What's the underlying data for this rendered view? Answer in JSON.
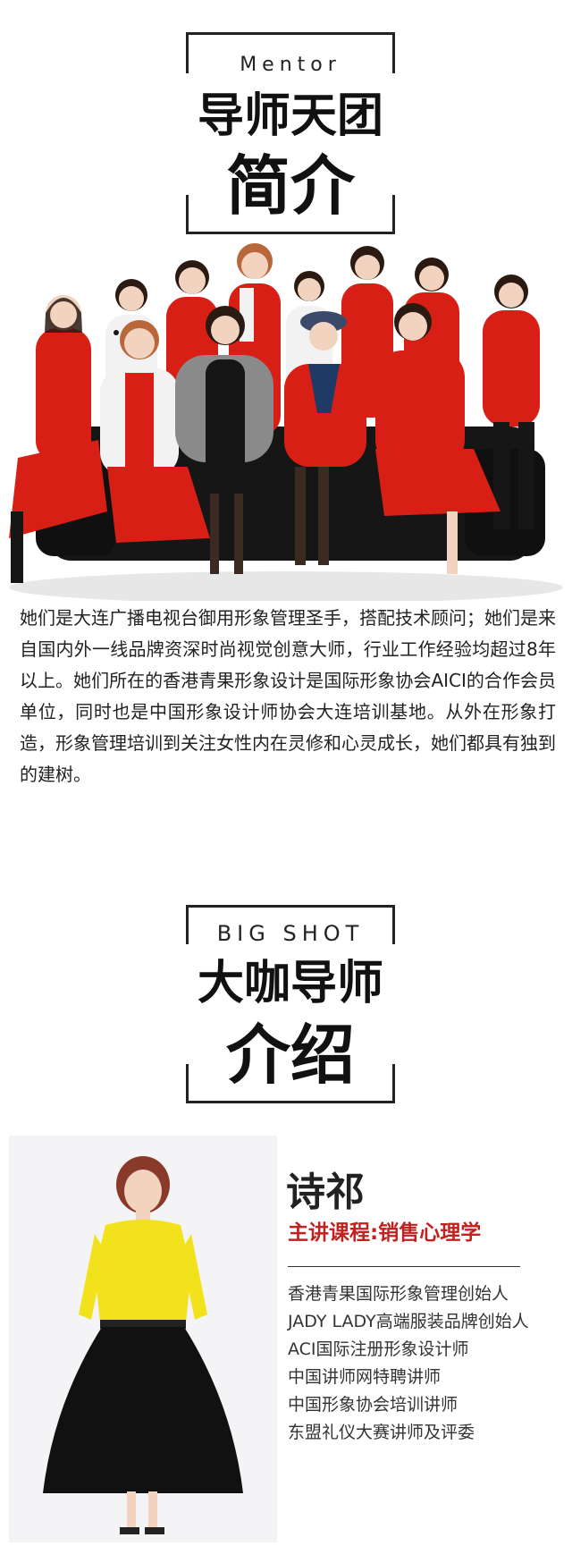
{
  "section1": {
    "en_label": "Mentor",
    "title_line1": "导师天团",
    "title_line2": "简介"
  },
  "group_photo": {
    "colors": {
      "red": "#d81f16",
      "white": "#f2f2f2",
      "black": "#161616",
      "skin": "#f1d3c0",
      "hair": "#2a1a12"
    }
  },
  "description": "她们是大连广播电视台御用形象管理圣手，搭配技术顾问；她们是来自国内外一线品牌资深时尚视觉创意大师，行业工作经验均超过8年以上。她们所在的香港青果形象设计是国际形象协会AICI的合作会员单位，同时也是中国形象设计师协会大连培训基地。从外在形象打造，形象管理培训到关注女性内在灵修和心灵成长，她们都具有独到的建树。",
  "section2": {
    "en_label": "BIG SHOT",
    "title_line1": "大咖导师",
    "title_line2": "介绍"
  },
  "mentor": {
    "name": "诗祁",
    "course": "主讲课程:销售心理学",
    "credentials": [
      "香港青果国际形象管理创始人",
      "JADY LADY高端服装品牌创始人",
      "ACI国际注册形象设计师",
      "中国讲师网特聘讲师",
      "中国形象协会培训讲师",
      "东盟礼仪大赛讲师及评委"
    ],
    "colors": {
      "blouse": "#f2e21c",
      "skirt": "#111111",
      "accent": "#c2221f"
    }
  }
}
